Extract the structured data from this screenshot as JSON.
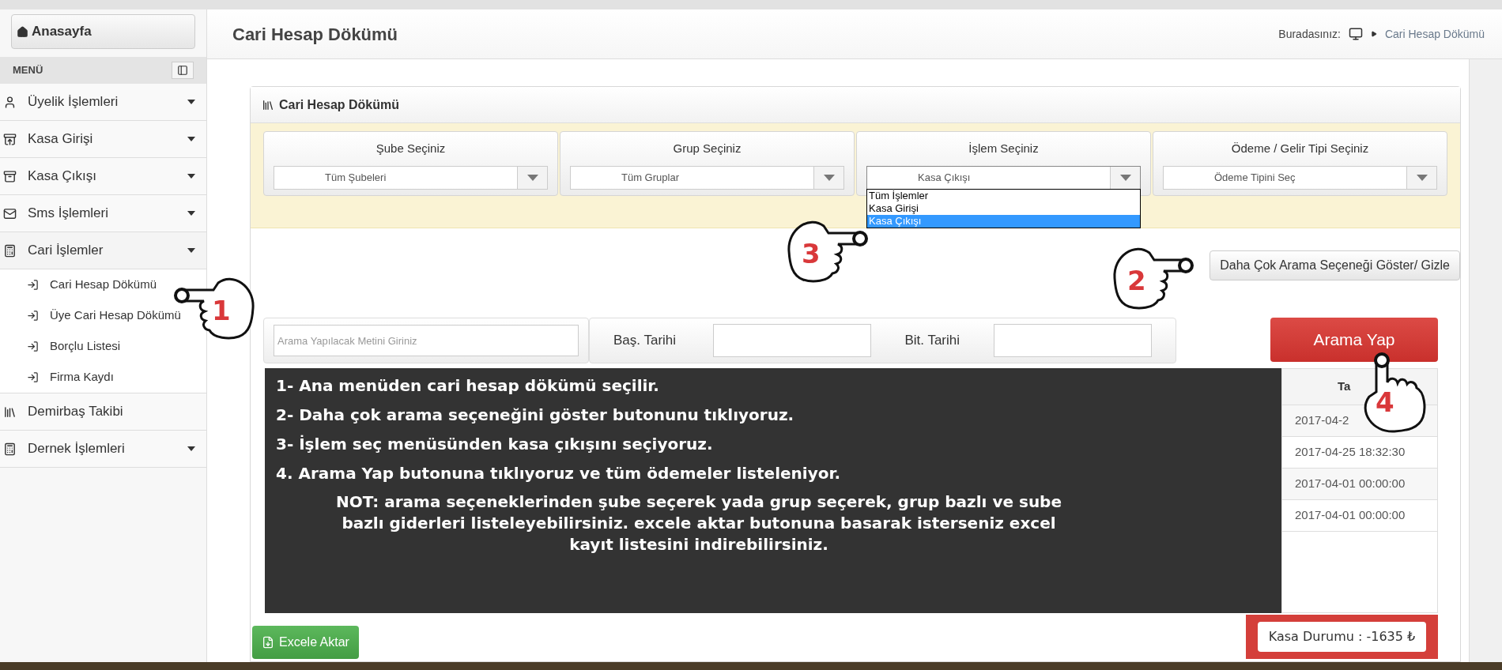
{
  "sidebar": {
    "home_button": "Anasayfa",
    "menu_title": "MENÜ",
    "items": [
      {
        "label": "Üyelik İşlemleri",
        "expandable": true,
        "expanded": false
      },
      {
        "label": "Kasa Girişi",
        "expandable": true,
        "expanded": false
      },
      {
        "label": "Kasa Çıkışı",
        "expandable": true,
        "expanded": false
      },
      {
        "label": "Sms İşlemleri",
        "expandable": true,
        "expanded": false
      },
      {
        "label": "Cari İşlemler",
        "expandable": true,
        "expanded": true,
        "children": [
          {
            "label": "Cari Hesap Dökümü"
          },
          {
            "label": "Üye Cari Hesap Dökümü"
          },
          {
            "label": "Borçlu Listesi"
          },
          {
            "label": "Firma Kaydı"
          }
        ]
      },
      {
        "label": "Demirbaş Takibi",
        "expandable": false,
        "expanded": false
      },
      {
        "label": "Dernek İşlemleri",
        "expandable": true,
        "expanded": false
      }
    ]
  },
  "header": {
    "title": "Cari Hesap Dökümü",
    "breadcrumb_label": "Buradasınız:",
    "breadcrumb_current": "Cari Hesap Dökümü"
  },
  "panel": {
    "title": "Cari Hesap Dökümü",
    "filters": [
      {
        "label": "Şube Seçiniz",
        "value": "Tüm Şubeleri",
        "open": false
      },
      {
        "label": "Grup Seçiniz",
        "value": "Tüm Gruplar",
        "open": false
      },
      {
        "label": "İşlem Seçiniz",
        "value": "Kasa Çıkışı",
        "open": true,
        "options": [
          {
            "label": "Tüm İşlemler",
            "selected": false
          },
          {
            "label": "Kasa Girişi",
            "selected": false
          },
          {
            "label": "Kasa Çıkışı",
            "selected": true
          }
        ]
      },
      {
        "label": "Ödeme / Gelir Tipi Seçiniz",
        "value": "Ödeme Tipini Seç",
        "open": false
      }
    ],
    "more_options_button": "Daha Çok Arama Seçeneği Göster/ Gizle",
    "search": {
      "placeholder": "Arama Yapılacak Metini Giriniz",
      "start_date_label": "Baş. Tarihi",
      "end_date_label": "Bit. Tarihi",
      "button": "Arama Yap"
    },
    "table": {
      "column_header": "Ta",
      "rows": [
        "2017-04-2",
        "2017-04-25 18:32:30",
        "2017-04-01 00:00:00",
        "2017-04-01 00:00:00"
      ]
    },
    "export_button": "Excele Aktar",
    "balance": "Kasa Durumu : -1635 ₺"
  },
  "instructions": {
    "steps": [
      "1- Ana menüden cari hesap dökümü seçilir.",
      "2- Daha çok arama seçeneğini göster butonunu tıklıyoruz.",
      "3- İşlem seç menüsünden kasa çıkışını seçiyoruz.",
      "4. Arama Yap butonuna tıklıyoruz ve tüm ödemeler listeleniyor."
    ],
    "note": "NOT:  arama seçeneklerinden şube seçerek yada grup seçerek, grup bazlı ve sube bazlı giderleri listeleyebilirsiniz. excele aktar butonuna basarak isterseniz excel kayıt listesini indirebilirsiniz."
  },
  "callouts": [
    {
      "number": "1"
    },
    {
      "number": "3"
    },
    {
      "number": "2"
    },
    {
      "number": "4"
    }
  ]
}
